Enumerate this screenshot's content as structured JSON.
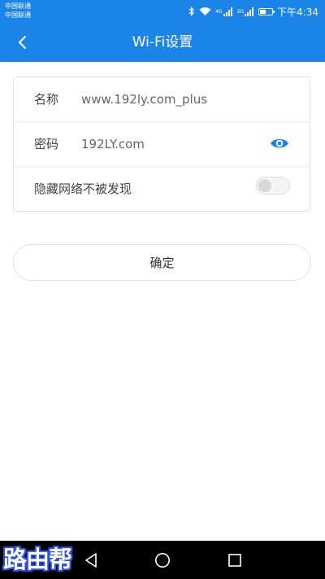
{
  "status_bar": {
    "carrier_1": "中国联通",
    "carrier_2": "中国联通",
    "network_1": "4G",
    "network_2": "2G",
    "time": "下午4:34",
    "icons": [
      "bluetooth-icon",
      "wifi-icon",
      "signal-icon",
      "signal-icon",
      "battery-icon"
    ]
  },
  "app_bar": {
    "title": "Wi-Fi设置",
    "back_icon": "back-arrow-icon",
    "color": "#1b84e7"
  },
  "form": {
    "name": {
      "label": "名称",
      "value": "www.192ly.com_plus"
    },
    "password": {
      "label": "密码",
      "value": "192LY.com",
      "icon": "eye-icon"
    },
    "hide_network": {
      "label": "隐藏网络不被发现",
      "on": false
    }
  },
  "confirm_label": "确定",
  "watermark": "路由帮",
  "nav_bar": {
    "icons": [
      "back-triangle-icon",
      "home-circle-icon",
      "recents-square-icon"
    ]
  }
}
